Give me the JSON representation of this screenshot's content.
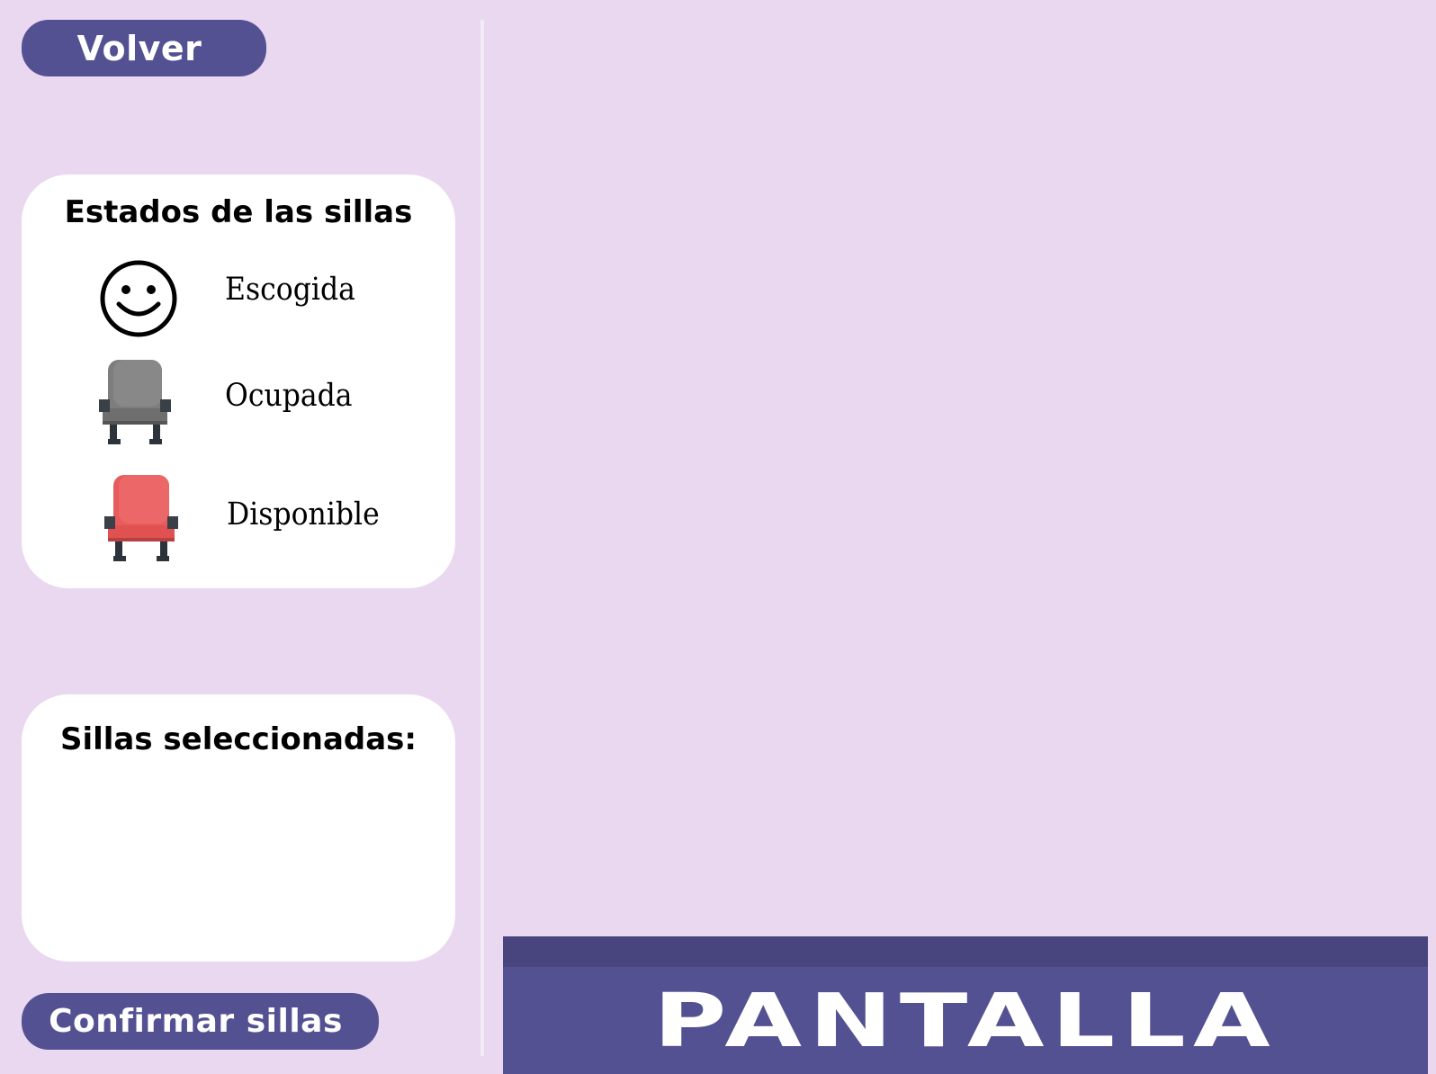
{
  "nav": {
    "back_label": "Volver"
  },
  "legend": {
    "title": "Estados de las sillas",
    "items": [
      {
        "icon": "smiley-icon",
        "label": "Escogida"
      },
      {
        "icon": "gray-seat-icon",
        "label": "Ocupada"
      },
      {
        "icon": "red-seat-icon",
        "label": "Disponible"
      }
    ]
  },
  "selected": {
    "title": "Sillas seleccionadas:"
  },
  "actions": {
    "confirm_label": "Confirmar sillas"
  },
  "screen": {
    "label": "PANTALLA"
  },
  "colors": {
    "background": "#ead8f0",
    "accent": "#545192",
    "screen_top": "#48447d",
    "seat_occupied": "#7d7d7d",
    "seat_available": "#e85b5b"
  }
}
